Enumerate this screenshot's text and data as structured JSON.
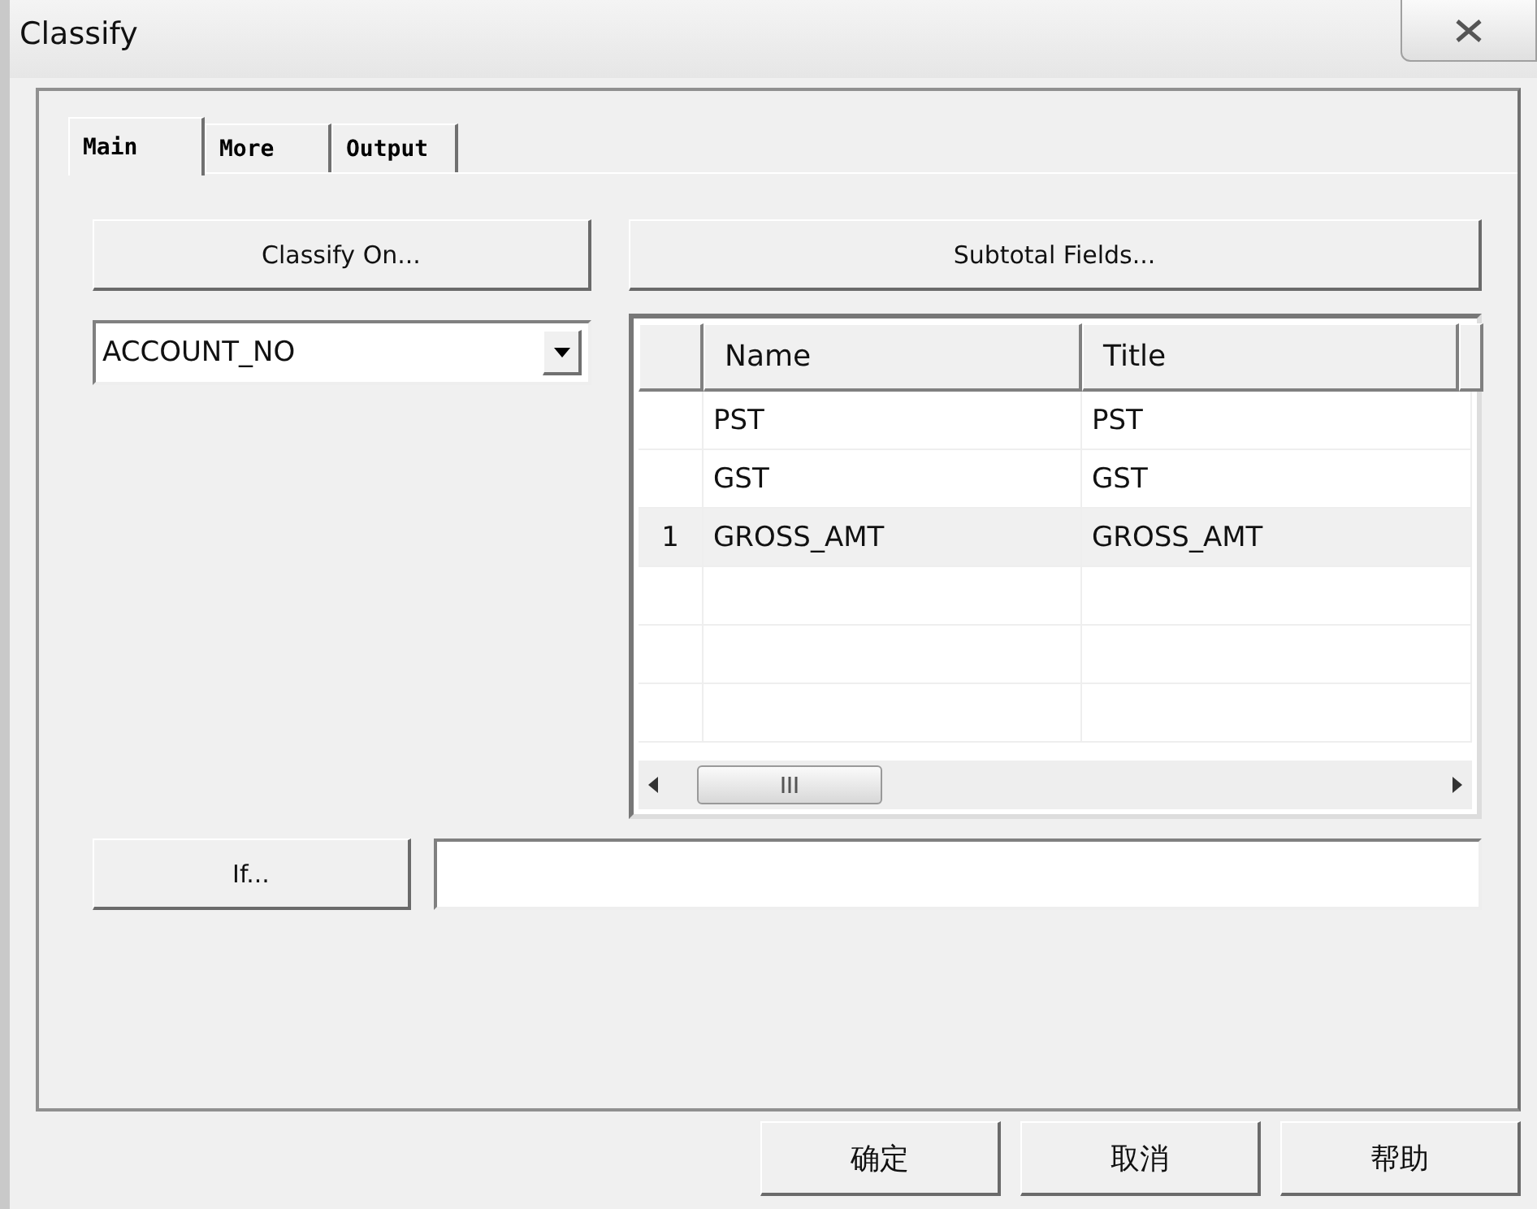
{
  "window": {
    "title": "Classify"
  },
  "tabs": [
    {
      "label": "Main",
      "selected": true
    },
    {
      "label": "More",
      "selected": false
    },
    {
      "label": "Output",
      "selected": false
    }
  ],
  "classify_on_button": "Classify On...",
  "subtotal_fields_button": "Subtotal Fields...",
  "classify_field": {
    "value": "ACCOUNT_NO"
  },
  "grid": {
    "columns": [
      "Name",
      "Title"
    ],
    "rows": [
      {
        "marker": "",
        "name": "PST",
        "title": "PST",
        "selected": false
      },
      {
        "marker": "",
        "name": "GST",
        "title": "GST",
        "selected": false
      },
      {
        "marker": "1",
        "name": "GROSS_AMT",
        "title": "GROSS_AMT",
        "selected": true
      }
    ]
  },
  "if_button": "If...",
  "buttons": [
    "确定",
    "取消",
    "帮助"
  ]
}
